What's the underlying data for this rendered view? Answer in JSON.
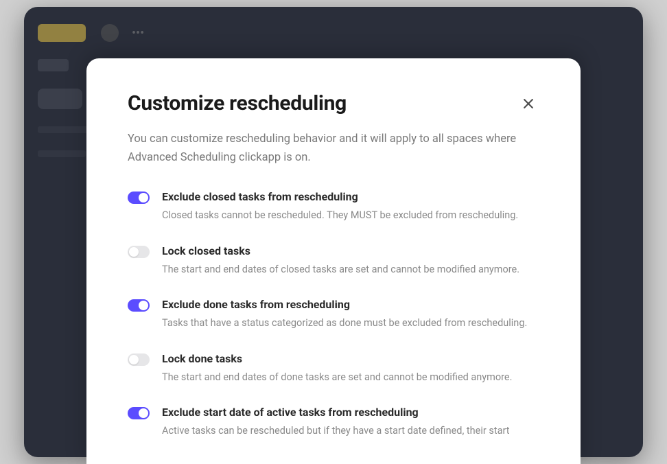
{
  "modal": {
    "title": "Customize rescheduling",
    "description": "You can customize rescheduling behavior and it will apply to all spaces where Advanced Scheduling clickapp is on.",
    "options": [
      {
        "enabled": true,
        "title": "Exclude closed tasks from rescheduling",
        "description": "Closed tasks cannot be rescheduled. They MUST be excluded from rescheduling."
      },
      {
        "enabled": false,
        "title": "Lock closed tasks",
        "description": "The start and end dates of closed tasks are set and cannot be modified anymore."
      },
      {
        "enabled": true,
        "title": "Exclude done tasks from rescheduling",
        "description": "Tasks that have a status categorized as done must be excluded from rescheduling."
      },
      {
        "enabled": false,
        "title": "Lock done tasks",
        "description": "The start and end dates of done tasks are set and cannot be modified anymore."
      },
      {
        "enabled": true,
        "title": "Exclude start date of active tasks from rescheduling",
        "description": "Active tasks can be rescheduled but if they have a start date defined, their start"
      }
    ]
  }
}
